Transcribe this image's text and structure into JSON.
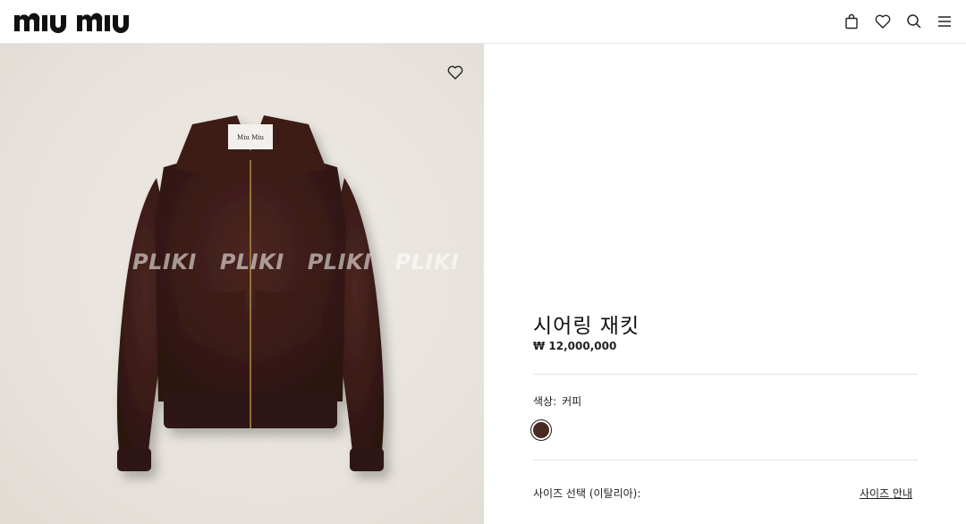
{
  "header": {
    "logo_text": "miu miu",
    "icons": [
      "bag-icon",
      "heart-icon",
      "search-icon",
      "menu-icon"
    ]
  },
  "image": {
    "watermark": [
      "PLIKI",
      "PLIKI",
      "PLIKI",
      "PLIKI",
      "PL"
    ],
    "jacket_label": "Miu Miu"
  },
  "product": {
    "name": "시어링 재킷",
    "price": "₩ 12,000,000",
    "color_label": "색상:",
    "color_value": "커피",
    "swatch_color": "#4a2a24",
    "size_label": "사이즈 선택 (이탈리아):",
    "size_guide": "사이즈 안내"
  }
}
